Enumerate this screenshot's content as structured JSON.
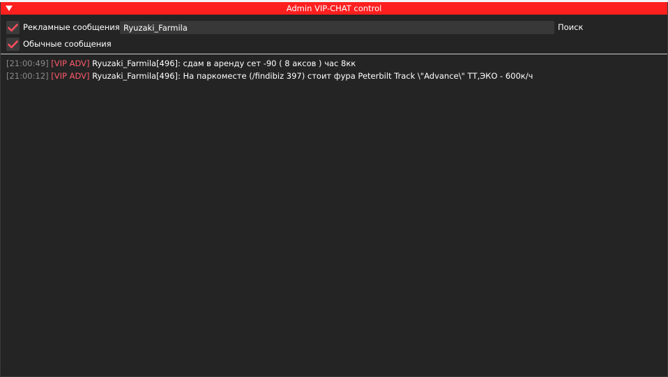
{
  "window": {
    "title": "Admin VIP-CHAT control"
  },
  "filters": {
    "ads": {
      "label": "Рекламные сообщения",
      "checked": true
    },
    "regular": {
      "label": "Обычные сообщения",
      "checked": true
    }
  },
  "search": {
    "value": "Ryuzaki_Farmila",
    "placeholder": "",
    "label": "Поиск"
  },
  "log": [
    {
      "time": "[21:00:49]",
      "tag": "[VIP ADV]",
      "text": "Ryuzaki_Farmila[496]: сдам в аренду сет -90 ( 8 аксов ) час 8кк"
    },
    {
      "time": "[21:00:12]",
      "tag": "[VIP ADV]",
      "text": "Ryuzaki_Farmila[496]: На паркоместе (/findibiz 397) стоит фура Peterbilt Track \\\"Advance\\\" ТТ,ЭКО - 600к/ч"
    }
  ],
  "colors": {
    "titlebar": "#fe1f1f",
    "background": "#242424",
    "check": "#ff4d5e",
    "tag": "#ff5a6a",
    "timestamp": "#8a8a8a"
  }
}
